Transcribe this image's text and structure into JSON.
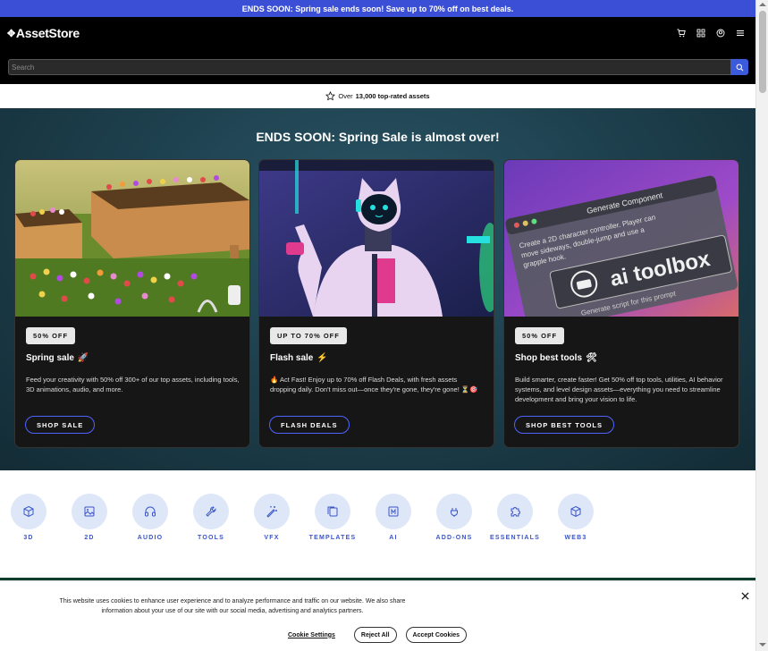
{
  "promo": {
    "text": "ENDS SOON: Spring sale ends soon! Save up to 70% off on best deals."
  },
  "header": {
    "logo_mark": "✥",
    "logo_text": "AssetStore",
    "icons": [
      "cart-icon",
      "apps-grid-icon",
      "account-icon",
      "menu-icon"
    ]
  },
  "search": {
    "placeholder": "Search",
    "value": ""
  },
  "rated": {
    "prefix": "Over",
    "count": "13,000 top-rated assets"
  },
  "sale": {
    "title": "ENDS SOON: Spring Sale is almost over!",
    "cards": [
      {
        "badge": "50% OFF",
        "title": "Spring sale",
        "emoji": "🚀",
        "desc": "Feed your creativity with 50% off 300+ of our top assets, including tools, 3D animations, audio, and more.",
        "cta": "SHOP SALE"
      },
      {
        "badge": "UP TO 70% OFF",
        "title": "Flash sale",
        "emoji": "⚡",
        "desc": "🔥 Act Fast! Enjoy up to 70% off Flash Deals, with fresh assets dropping daily. Don't miss out—once they're gone, they're gone! ⏳🎯",
        "cta": "FLASH DEALS"
      },
      {
        "badge": "50% OFF",
        "title": "Shop best tools",
        "emoji": "🛠",
        "desc": "Build smarter, create faster! Get 50% off top tools, utilities, AI behavior systems, and level design assets—everything you need to streamline development and bring your vision to life.",
        "cta": "SHOP BEST TOOLS",
        "image": {
          "window_title": "Generate Component",
          "prompt": "Create a 2D character controller. Player can move sideways, double-jump and use a grapple hook.",
          "brand": "ai toolbox",
          "footer": "Generate script for this prompt"
        }
      }
    ]
  },
  "categories": [
    {
      "label": "3D",
      "icon": "cube-icon"
    },
    {
      "label": "2D",
      "icon": "image-icon"
    },
    {
      "label": "AUDIO",
      "icon": "headphones-icon"
    },
    {
      "label": "TOOLS",
      "icon": "wrench-icon"
    },
    {
      "label": "VFX",
      "icon": "magic-wand-icon"
    },
    {
      "label": "TEMPLATES",
      "icon": "templates-icon"
    },
    {
      "label": "AI",
      "icon": "ai-chip-icon"
    },
    {
      "label": "ADD-ONS",
      "icon": "plug-icon"
    },
    {
      "label": "ESSENTIALS",
      "icon": "puzzle-icon"
    },
    {
      "label": "WEB3",
      "icon": "web3-cube-icon"
    }
  ],
  "cookie": {
    "line1": "This website uses cookies to enhance user experience and to analyze performance and traffic on our website. We also share",
    "line2": "information about your use of our site with our social media, advertising and analytics partners.",
    "settings": "Cookie Settings",
    "reject": "Reject All",
    "accept": "Accept Cookies"
  },
  "colors": {
    "accent": "#3b4fd6",
    "category_bg": "#dde7f7",
    "category_text": "#3a55c9"
  }
}
